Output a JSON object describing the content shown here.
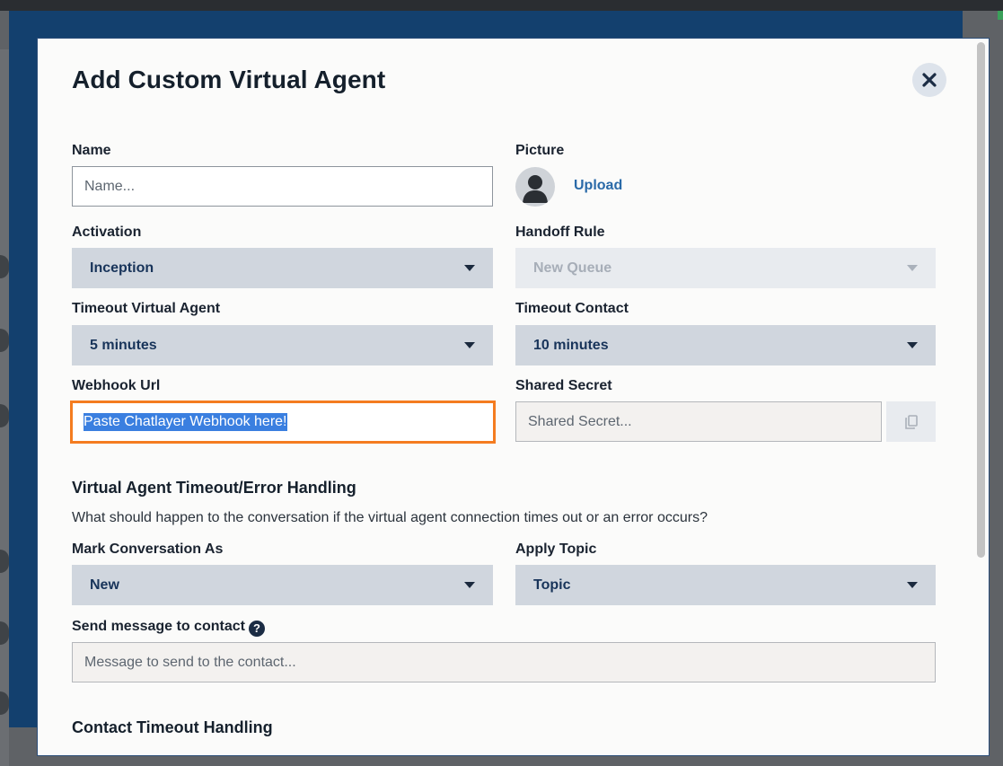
{
  "modal": {
    "title": "Add Custom Virtual Agent",
    "close_label": "×"
  },
  "fields": {
    "name": {
      "label": "Name",
      "placeholder": "Name..."
    },
    "picture": {
      "label": "Picture",
      "upload_label": "Upload"
    },
    "activation": {
      "label": "Activation",
      "value": "Inception"
    },
    "handoff_rule": {
      "label": "Handoff Rule",
      "value": "New Queue"
    },
    "timeout_virtual_agent": {
      "label": "Timeout Virtual Agent",
      "value": "5 minutes"
    },
    "timeout_contact": {
      "label": "Timeout Contact",
      "value": "10 minutes"
    },
    "webhook_url": {
      "label": "Webhook Url",
      "value": "Paste Chatlayer Webhook here!"
    },
    "shared_secret": {
      "label": "Shared Secret",
      "placeholder": "Shared Secret..."
    }
  },
  "error_handling": {
    "title": "Virtual Agent Timeout/Error Handling",
    "description": "What should happen to the conversation if the virtual agent connection times out or an error occurs?",
    "mark_conversation_as": {
      "label": "Mark Conversation As",
      "value": "New"
    },
    "apply_topic": {
      "label": "Apply Topic",
      "value": "Topic"
    },
    "send_message": {
      "label": "Send message to contact",
      "placeholder": "Message to send to the contact..."
    }
  },
  "contact_timeout": {
    "title": "Contact Timeout Handling"
  },
  "colors": {
    "accent_focus": "#f47c20",
    "select_bg": "#d0d6de",
    "link": "#2a6aa8",
    "header_blue": "#13406e"
  }
}
